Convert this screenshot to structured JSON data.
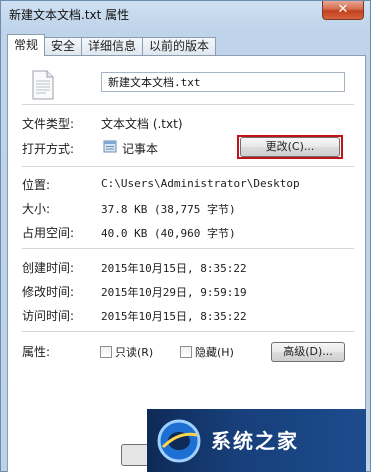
{
  "window": {
    "title": "新建文本文档.txt 属性",
    "close_label": "✕"
  },
  "tabs": [
    {
      "label": "常规",
      "active": true
    },
    {
      "label": "安全",
      "active": false
    },
    {
      "label": "详细信息",
      "active": false
    },
    {
      "label": "以前的版本",
      "active": false
    }
  ],
  "general": {
    "file_name": "新建文本文档.txt",
    "file_type_label": "文件类型:",
    "file_type_value": "文本文档 (.txt)",
    "open_with_label": "打开方式:",
    "open_with_value": "记事本",
    "change_button": "更改(C)...",
    "location_label": "位置:",
    "location_value": "C:\\Users\\Administrator\\Desktop",
    "size_label": "大小:",
    "size_value": "37.8 KB (38,775 字节)",
    "disk_size_label": "占用空间:",
    "disk_size_value": "40.0 KB (40,960 字节)",
    "created_label": "创建时间:",
    "created_value": "2015年10月15日, 8:35:22",
    "modified_label": "修改时间:",
    "modified_value": "2015年10月29日, 9:59:19",
    "accessed_label": "访问时间:",
    "accessed_value": "2015年10月15日, 8:35:22",
    "attributes_label": "属性:",
    "readonly_label": "只读(R)",
    "hidden_label": "隐藏(H)",
    "advanced_button": "高级(D)..."
  },
  "watermark": {
    "text": "系统之家"
  },
  "icons": {
    "file": "text-file-icon",
    "app": "notepad-icon",
    "logo": "system-home-logo-icon"
  },
  "colors": {
    "highlight_border": "#c0141a",
    "close_button": "#c94a2b",
    "frame": "#bcd2e8"
  }
}
